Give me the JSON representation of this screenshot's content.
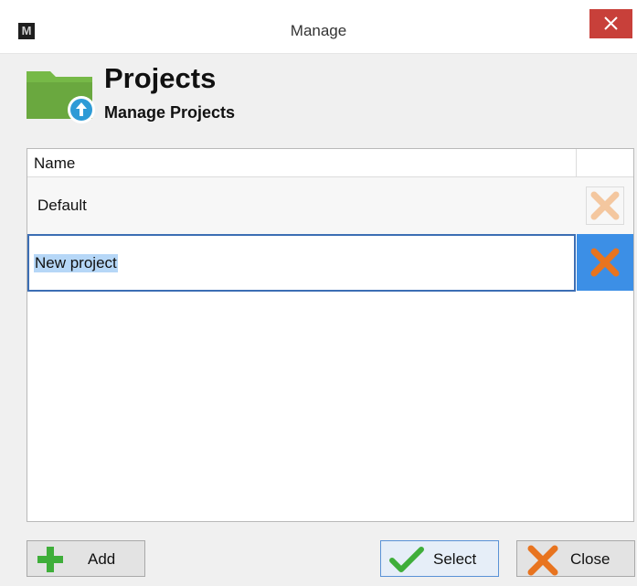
{
  "window": {
    "title": "Manage",
    "app_icon_letter": "M"
  },
  "header": {
    "title": "Projects",
    "subtitle": "Manage Projects"
  },
  "list": {
    "column_name": "Name",
    "rows": [
      {
        "label": "Default",
        "state": "normal"
      },
      {
        "label": "New project",
        "state": "editing-selected"
      }
    ]
  },
  "buttons": {
    "add_label": "Add",
    "select_label": "Select",
    "close_label": "Close"
  },
  "colors": {
    "folder_green": "#76b947",
    "badge_blue": "#2e9bd6",
    "delete_orange": "#e8741f",
    "delete_orange_faded": "#f4c79f",
    "selection_blue": "#3c8fe6",
    "add_green": "#3fae3a",
    "check_green": "#3fae3a",
    "titlebar_close_red": "#c8403a"
  },
  "icons": {
    "app": "m-app-icon",
    "window_close": "window-close-icon",
    "header": "folder-upload-icon",
    "delete": "delete-x-icon",
    "add": "plus-icon",
    "select": "checkmark-icon",
    "close": "close-x-icon"
  }
}
